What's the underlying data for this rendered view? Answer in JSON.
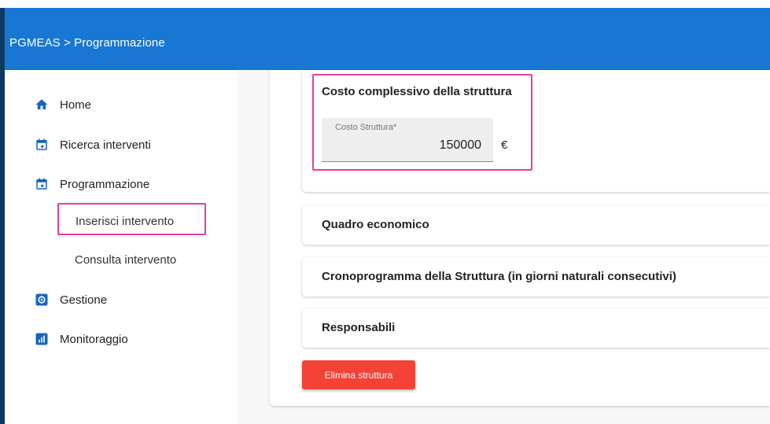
{
  "header": {
    "title": "PGMEAS > Programmazione"
  },
  "sidebar": {
    "items": [
      {
        "label": "Home",
        "icon": "home-icon"
      },
      {
        "label": "Ricerca interventi",
        "icon": "calendar-icon"
      },
      {
        "label": "Programmazione",
        "icon": "calendar-icon"
      },
      {
        "label": "Gestione",
        "icon": "settings-icon"
      },
      {
        "label": "Monitoraggio",
        "icon": "chart-icon"
      }
    ],
    "subitems": [
      {
        "label": "Inserisci intervento",
        "highlighted": true
      },
      {
        "label": "Consulta intervento",
        "highlighted": false
      }
    ]
  },
  "main": {
    "cost_section": {
      "title": "Costo complessivo della struttura",
      "field_label": "Costo Struttura*",
      "field_value": "150000",
      "currency": "€"
    },
    "accordions": [
      {
        "title": "Quadro economico"
      },
      {
        "title": "Cronoprogramma della Struttura (in giorni naturali consecutivi)"
      },
      {
        "title": "Responsabili"
      }
    ],
    "delete_button": "Elimina struttura"
  },
  "colors": {
    "appbar": "#1877d2",
    "icon": "#1565c0",
    "highlight": "#e83e9a",
    "delete": "#f44336"
  }
}
